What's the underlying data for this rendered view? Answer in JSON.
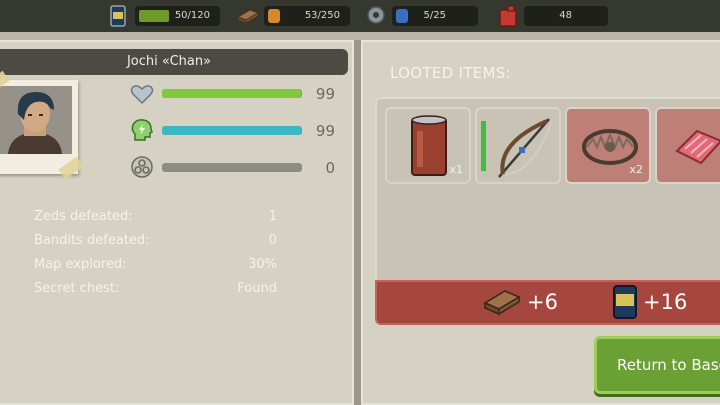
{
  "resources": [
    {
      "name": "food",
      "icon": "can-icon",
      "value": "50/120",
      "fill_fraction": 0.4167
    },
    {
      "name": "materials",
      "icon": "wood-icon",
      "value": "53/250"
    },
    {
      "name": "parts",
      "icon": "gear-icon",
      "value": "5/25"
    },
    {
      "name": "fuel",
      "icon": "fuel-canister-icon",
      "value": "48"
    }
  ],
  "character": {
    "name": "Jochi «Chan»",
    "stats": [
      {
        "name": "health",
        "icon": "heart-icon",
        "value": "99",
        "fraction": 0.99,
        "color": "#7fc93a"
      },
      {
        "name": "energy",
        "icon": "energy-head-icon",
        "value": "99",
        "fraction": 0.99,
        "color": "#3bb7c4"
      },
      {
        "name": "infection",
        "icon": "biohazard-icon",
        "value": "0",
        "fraction": 0
      }
    ],
    "info": [
      {
        "label": "Zeds defeated:",
        "value": "1"
      },
      {
        "label": "Bandits defeated:",
        "value": "0"
      },
      {
        "label": "Map explored:",
        "value": "30%"
      },
      {
        "label": "Secret chest:",
        "value": "Found"
      }
    ]
  },
  "loot": {
    "title": "LOOTED ITEMS:",
    "items": [
      {
        "icon": "can-icon",
        "count": "x1",
        "bg": "#c8c3b4"
      },
      {
        "icon": "bow-icon",
        "count": "",
        "bg": "#c8c3b4"
      },
      {
        "icon": "bear-trap-icon",
        "count": "x2",
        "bg": "#bd7f76"
      },
      {
        "icon": "meat-icon",
        "count": "",
        "bg": "#bd7f76"
      }
    ],
    "rewards": [
      {
        "icon": "wood-icon",
        "value": "+6"
      },
      {
        "icon": "can-icon",
        "value": "+16"
      }
    ]
  },
  "return_button": "Return to Base"
}
